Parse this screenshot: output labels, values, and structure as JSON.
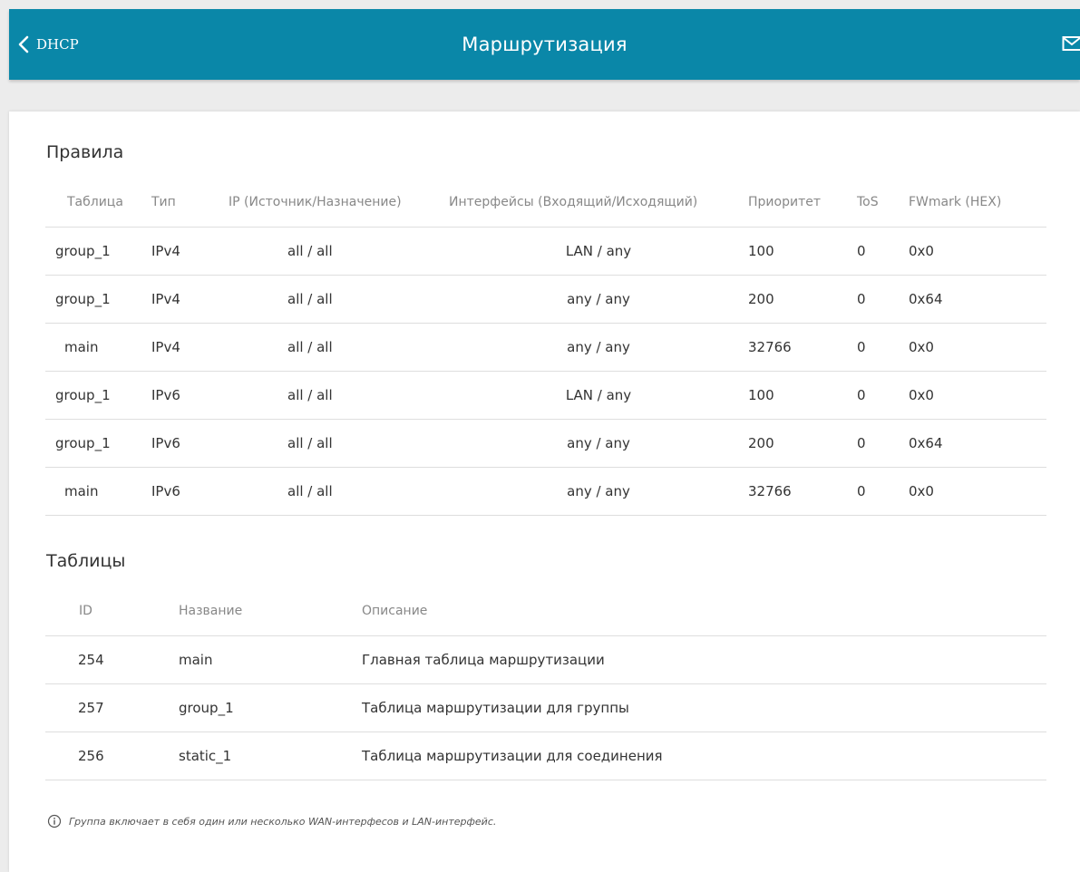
{
  "header": {
    "back_label": "DHCP",
    "title": "Маршрутизация"
  },
  "rules": {
    "title": "Правила",
    "columns": [
      "Таблица",
      "Тип",
      "IP (Источник/Назначение)",
      "Интерфейсы (Входящий/Исходящий)",
      "Приоритет",
      "ToS",
      "FWmark (HEX)"
    ],
    "rows": [
      [
        "group_1",
        "IPv4",
        "all / all",
        "LAN / any",
        "100",
        "0",
        "0x0"
      ],
      [
        "group_1",
        "IPv4",
        "all / all",
        "any / any",
        "200",
        "0",
        "0x64"
      ],
      [
        "main",
        "IPv4",
        "all / all",
        "any / any",
        "32766",
        "0",
        "0x0"
      ],
      [
        "group_1",
        "IPv6",
        "all / all",
        "LAN / any",
        "100",
        "0",
        "0x0"
      ],
      [
        "group_1",
        "IPv6",
        "all / all",
        "any / any",
        "200",
        "0",
        "0x64"
      ],
      [
        "main",
        "IPv6",
        "all / all",
        "any / any",
        "32766",
        "0",
        "0x0"
      ]
    ]
  },
  "tables": {
    "title": "Таблицы",
    "columns": [
      "ID",
      "Название",
      "Описание"
    ],
    "rows": [
      [
        "254",
        "main",
        "Главная таблица маршрутизации"
      ],
      [
        "257",
        "group_1",
        "Таблица маршрутизации для группы"
      ],
      [
        "256",
        "static_1",
        "Таблица маршрутизации для соединения"
      ]
    ]
  },
  "note": {
    "text": "Группа включает в себя один или несколько WAN-интерфесов и LAN-интерфейс."
  },
  "icons": {
    "back": "chevron-left-icon",
    "mail": "envelope-icon",
    "info": "info-icon"
  },
  "colors": {
    "header_bg": "#0a87a8",
    "page_bg": "#ececec",
    "text": "#333333",
    "muted": "#888888"
  }
}
